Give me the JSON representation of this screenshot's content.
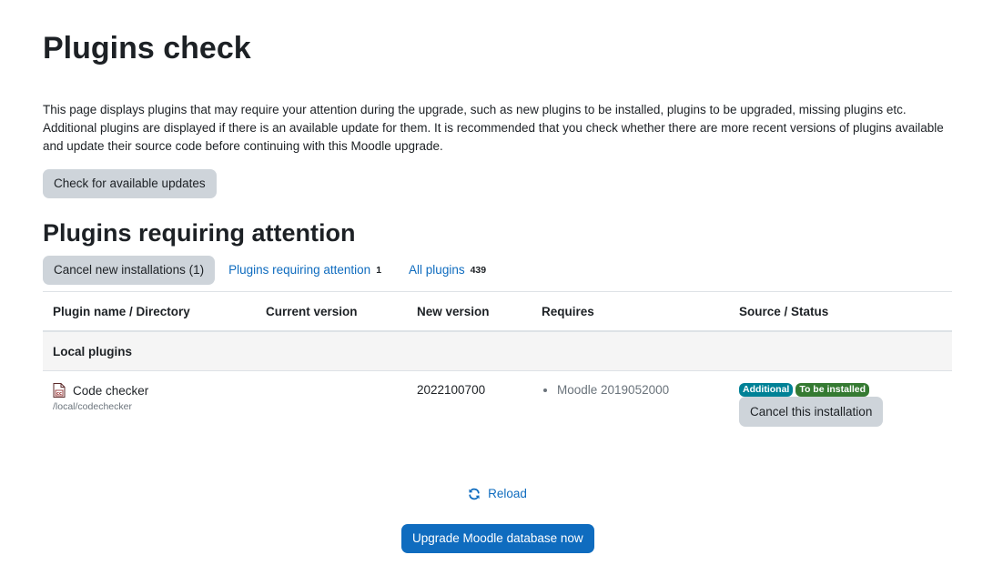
{
  "page": {
    "title": "Plugins check",
    "intro": "This page displays plugins that may require your attention during the upgrade, such as new plugins to be installed, plugins to be upgraded, missing plugins etc. Additional plugins are displayed if there is an available update for them. It is recommended that you check whether there are more recent versions of plugins available and update their source code before continuing with this Moodle upgrade.",
    "check_updates_label": "Check for available updates"
  },
  "section": {
    "title": "Plugins requiring attention",
    "tabs": [
      {
        "label": "Cancel new installations (1)"
      },
      {
        "label": "Plugins requiring attention",
        "count": "1"
      },
      {
        "label": "All plugins",
        "count": "439"
      }
    ]
  },
  "table": {
    "headers": [
      "Plugin name / Directory",
      "Current version",
      "New version",
      "Requires",
      "Source / Status"
    ],
    "group": "Local plugins",
    "rows": [
      {
        "name": "Code checker",
        "directory": "/local/codechecker",
        "current_version": "",
        "new_version": "2022100700",
        "requires": "Moodle 2019052000",
        "badges": [
          "Additional",
          "To be installed"
        ],
        "action_label": "Cancel this installation"
      }
    ]
  },
  "footer": {
    "reload_label": "Reload",
    "upgrade_label": "Upgrade Moodle database now"
  },
  "colors": {
    "link": "#0f6cbf",
    "badge_info": "#008196",
    "badge_success": "#357a32",
    "secondary_button": "#ced4da"
  },
  "icons": {
    "plugin": "file-icon",
    "reload": "refresh-icon"
  }
}
